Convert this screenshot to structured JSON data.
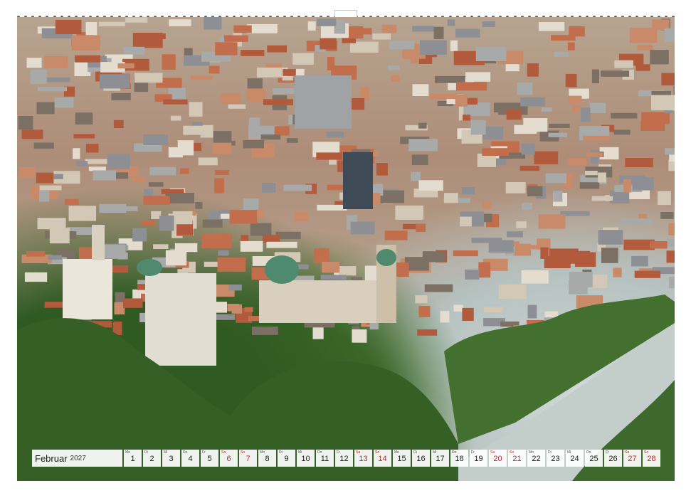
{
  "calendar": {
    "month": "Februar",
    "year": "2027",
    "days": [
      {
        "wd": "Mo",
        "d": "1",
        "we": false
      },
      {
        "wd": "Di",
        "d": "2",
        "we": false
      },
      {
        "wd": "Mi",
        "d": "3",
        "we": false
      },
      {
        "wd": "Do",
        "d": "4",
        "we": false
      },
      {
        "wd": "Fr",
        "d": "5",
        "we": false
      },
      {
        "wd": "Sa",
        "d": "6",
        "we": true
      },
      {
        "wd": "So",
        "d": "7",
        "we": true
      },
      {
        "wd": "Mo",
        "d": "8",
        "we": false
      },
      {
        "wd": "Di",
        "d": "9",
        "we": false
      },
      {
        "wd": "Mi",
        "d": "10",
        "we": false
      },
      {
        "wd": "Do",
        "d": "11",
        "we": false
      },
      {
        "wd": "Fr",
        "d": "12",
        "we": false
      },
      {
        "wd": "Sa",
        "d": "13",
        "we": true
      },
      {
        "wd": "So",
        "d": "14",
        "we": true
      },
      {
        "wd": "Mo",
        "d": "15",
        "we": false
      },
      {
        "wd": "Di",
        "d": "16",
        "we": false
      },
      {
        "wd": "Mi",
        "d": "17",
        "we": false
      },
      {
        "wd": "Do",
        "d": "18",
        "we": false
      },
      {
        "wd": "Fr",
        "d": "19",
        "we": false
      },
      {
        "wd": "Sa",
        "d": "20",
        "we": true
      },
      {
        "wd": "So",
        "d": "21",
        "we": true
      },
      {
        "wd": "Mo",
        "d": "22",
        "we": false
      },
      {
        "wd": "Di",
        "d": "23",
        "we": false
      },
      {
        "wd": "Mi",
        "d": "24",
        "we": false
      },
      {
        "wd": "Do",
        "d": "25",
        "we": false
      },
      {
        "wd": "Fr",
        "d": "26",
        "we": false
      },
      {
        "wd": "Sa",
        "d": "27",
        "we": true
      },
      {
        "wd": "So",
        "d": "28",
        "we": true
      }
    ]
  },
  "colors": {
    "weekend": "#c1272d",
    "roof": "#b25a3c",
    "dome": "#4f8a6e",
    "river": "#c3ceca",
    "trees": "#355f25"
  }
}
